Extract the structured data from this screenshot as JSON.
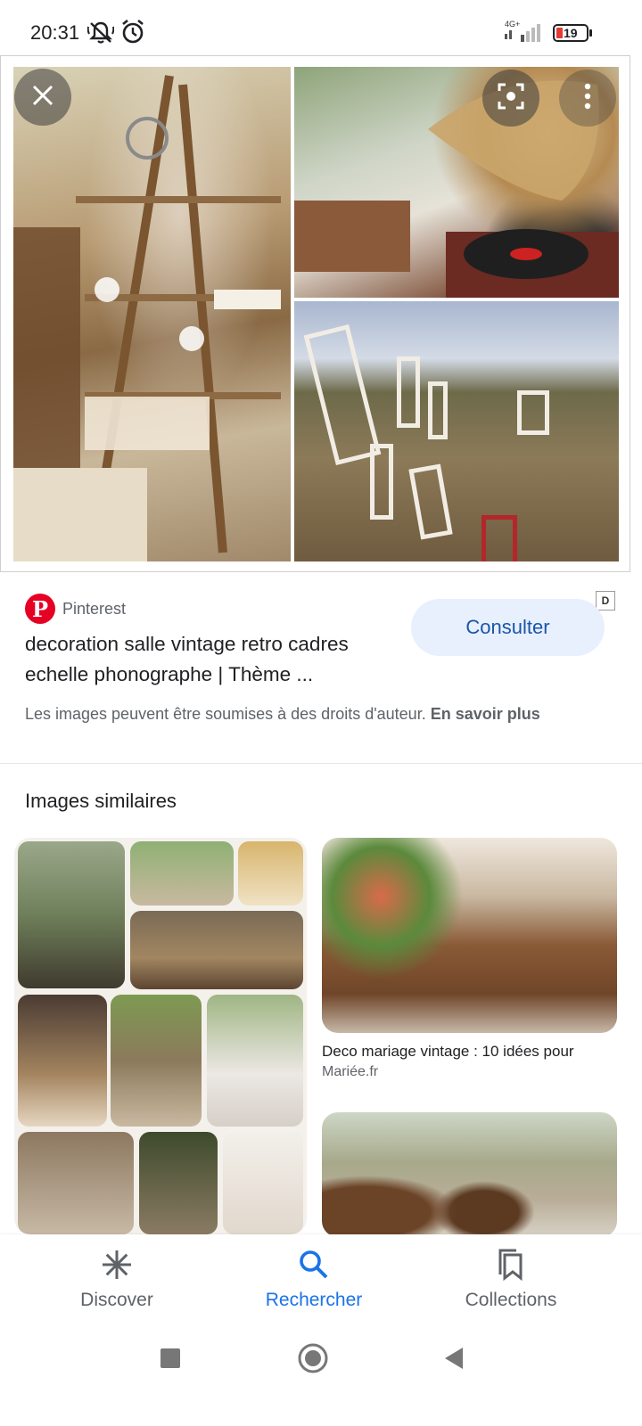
{
  "status_bar": {
    "time": "20:31",
    "network": "4G+",
    "battery": "19",
    "icons": [
      "mute-icon",
      "alarm-icon",
      "signal-icon",
      "battery-icon"
    ]
  },
  "image_viewer": {
    "close_icon": "close-icon",
    "lens_icon": "lens-icon",
    "more_icon": "more-vert-icon",
    "watermark": "D"
  },
  "result": {
    "source_name": "Pinterest",
    "title": "decoration salle vintage retro cadres echelle phonographe | Thème ...",
    "visit_label": "Consulter",
    "copyright_text": "Les images peuvent être soumises à des droits d'auteur.",
    "learn_more": "En savoir plus"
  },
  "similar": {
    "section_title": "Images similaires",
    "cards": [
      {
        "caption": "Deco mariage vintage : 10 idées pour",
        "source": "Mariée.fr"
      }
    ]
  },
  "bottom_nav": {
    "items": [
      {
        "label": "Discover",
        "icon": "discover-icon"
      },
      {
        "label": "Rechercher",
        "icon": "search-icon",
        "active": true
      },
      {
        "label": "Collections",
        "icon": "collections-icon"
      }
    ],
    "active_color": "#1a73e8"
  },
  "colors": {
    "accent": "#1a73e8",
    "pinterest": "#e60023",
    "visit_button_bg": "#e8f0fe"
  }
}
